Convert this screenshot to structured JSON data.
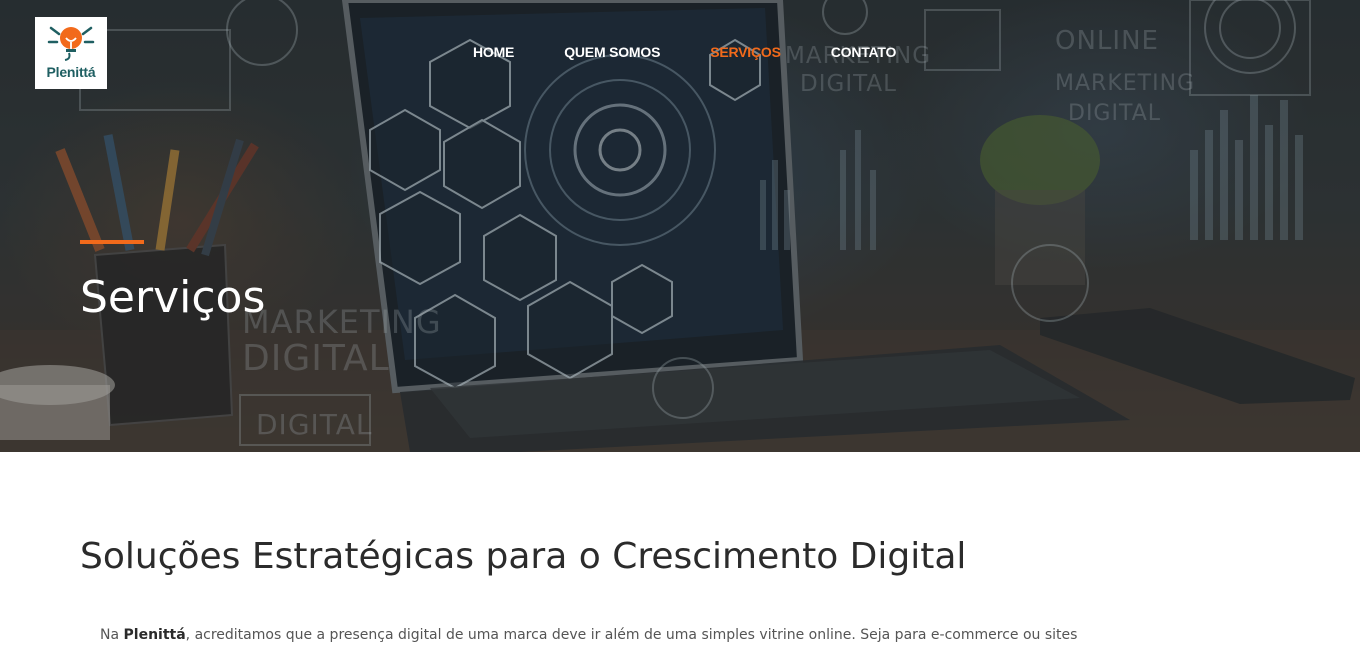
{
  "brand": {
    "name": "Plenittá",
    "colors": {
      "accent": "#f26a1b",
      "logo_teal": "#1f5f62"
    }
  },
  "nav": {
    "items": [
      {
        "label": "HOME",
        "active": false
      },
      {
        "label": "QUEM SOMOS",
        "active": false
      },
      {
        "label": "SERVIÇOS",
        "active": true
      },
      {
        "label": "CONTATO",
        "active": false
      }
    ]
  },
  "hero": {
    "title": "Serviços",
    "background_words": [
      "MARKETING",
      "DIGITAL",
      "ONLINE",
      "MARKETING",
      "DIGITAL",
      "MARKETING",
      "DIGITAL",
      "DIGITAL"
    ]
  },
  "main": {
    "heading": "Soluções Estratégicas para o Crescimento Digital",
    "intro_prefix": "Na ",
    "intro_brand": "Plenittá",
    "intro_rest": ", acreditamos que a presença digital de uma marca deve ir além de uma simples vitrine online. Seja para e-commerce ou sites"
  },
  "icons": [
    "lightbulb-logo-icon"
  ]
}
